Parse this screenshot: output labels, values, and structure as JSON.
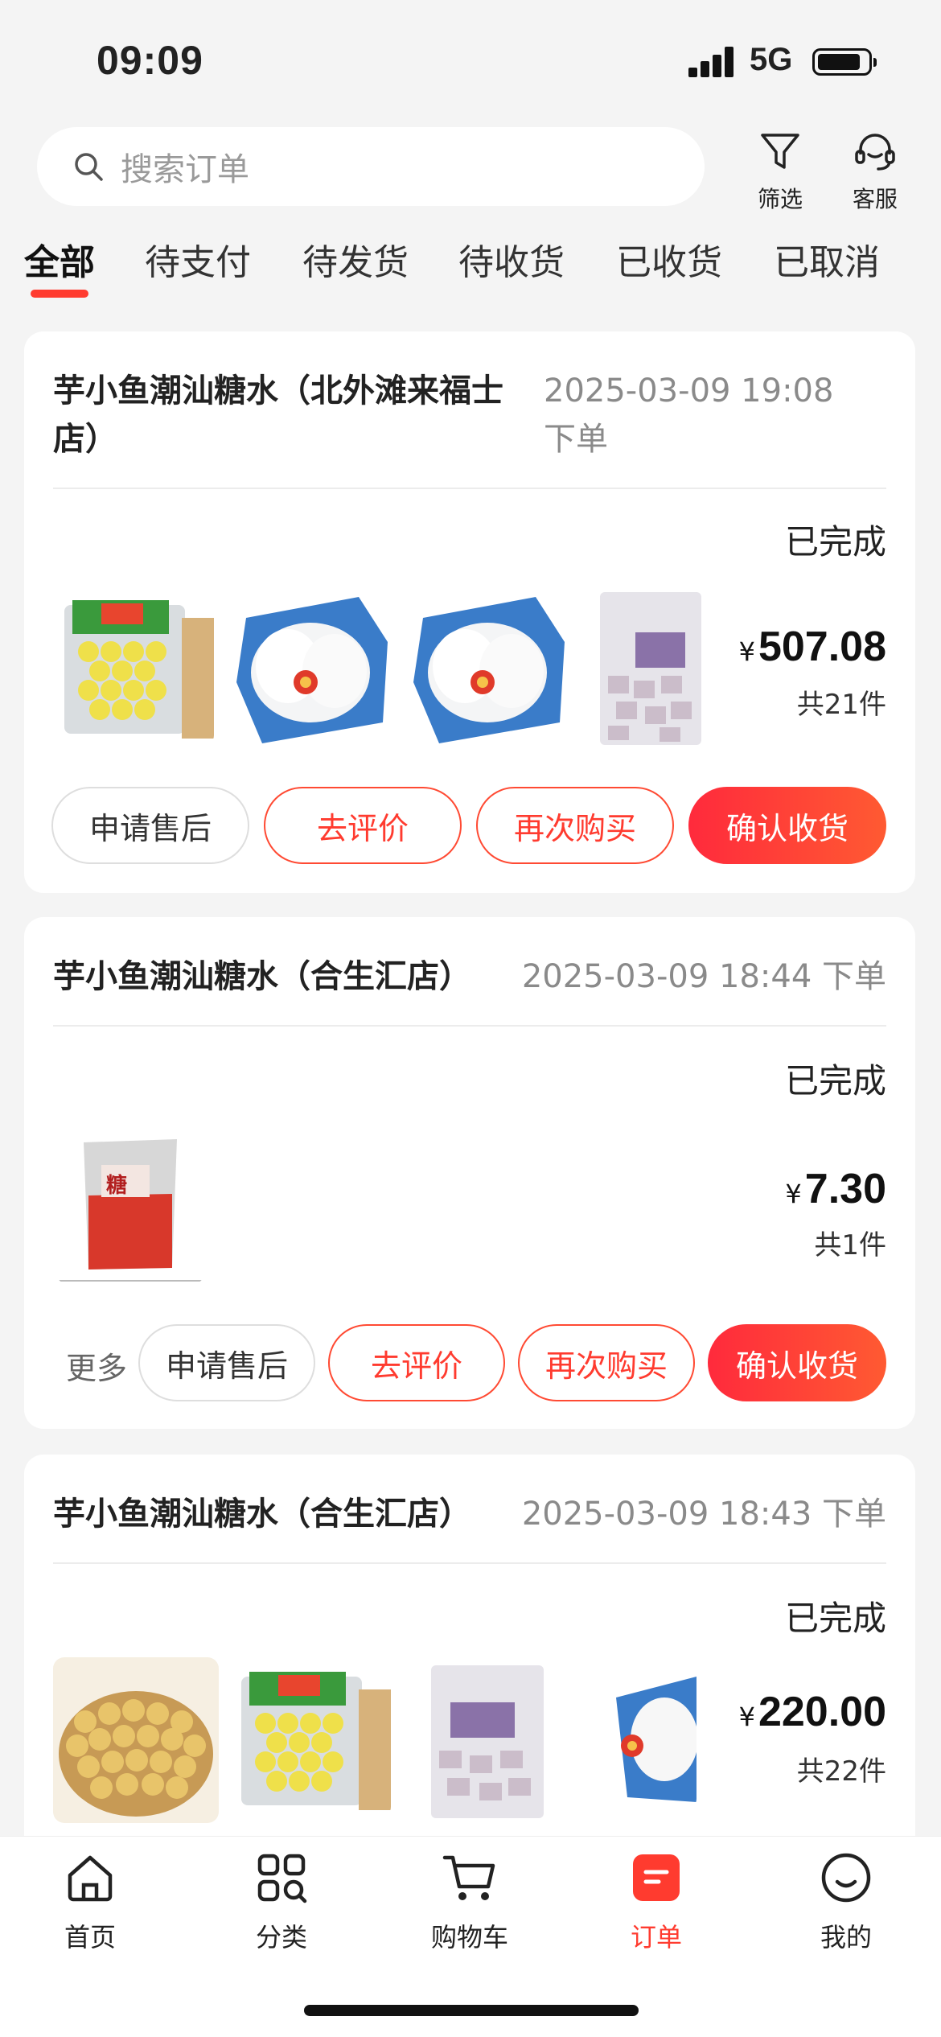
{
  "status_bar": {
    "time": "09:09",
    "network": "5G"
  },
  "header": {
    "search_placeholder": "搜索订单",
    "filter_label": "筛选",
    "service_label": "客服"
  },
  "tabs": [
    "全部",
    "待支付",
    "待发货",
    "待收货",
    "已收货",
    "已取消"
  ],
  "orders": [
    {
      "shop_line1": "芋小鱼潮汕糖水（北外滩来福士",
      "shop_line2": "店）",
      "date_line1": "2025-03-09 19:08",
      "date_line2": "下单",
      "status": "已完成",
      "currency": "¥",
      "amount": "507.08",
      "count": "共21件",
      "actions": [
        "申请售后",
        "去评价",
        "再次购买",
        "确认收货"
      ]
    },
    {
      "shop": "芋小鱼潮汕糖水（合生汇店）",
      "date": "2025-03-09 18:44 下单",
      "status": "已完成",
      "currency": "¥",
      "amount": "7.30",
      "count": "共1件",
      "more": "更多",
      "actions": [
        "申请售后",
        "去评价",
        "再次购买",
        "确认收货"
      ]
    },
    {
      "shop": "芋小鱼潮汕糖水（合生汇店）",
      "date": "2025-03-09 18:43 下单",
      "status": "已完成",
      "currency": "¥",
      "amount": "220.00",
      "count": "共22件"
    }
  ],
  "bottom_nav": [
    "首页",
    "分类",
    "购物车",
    "订单",
    "我的"
  ],
  "colors": {
    "accent": "#ff3b2f",
    "background": "#f4f4f4"
  }
}
